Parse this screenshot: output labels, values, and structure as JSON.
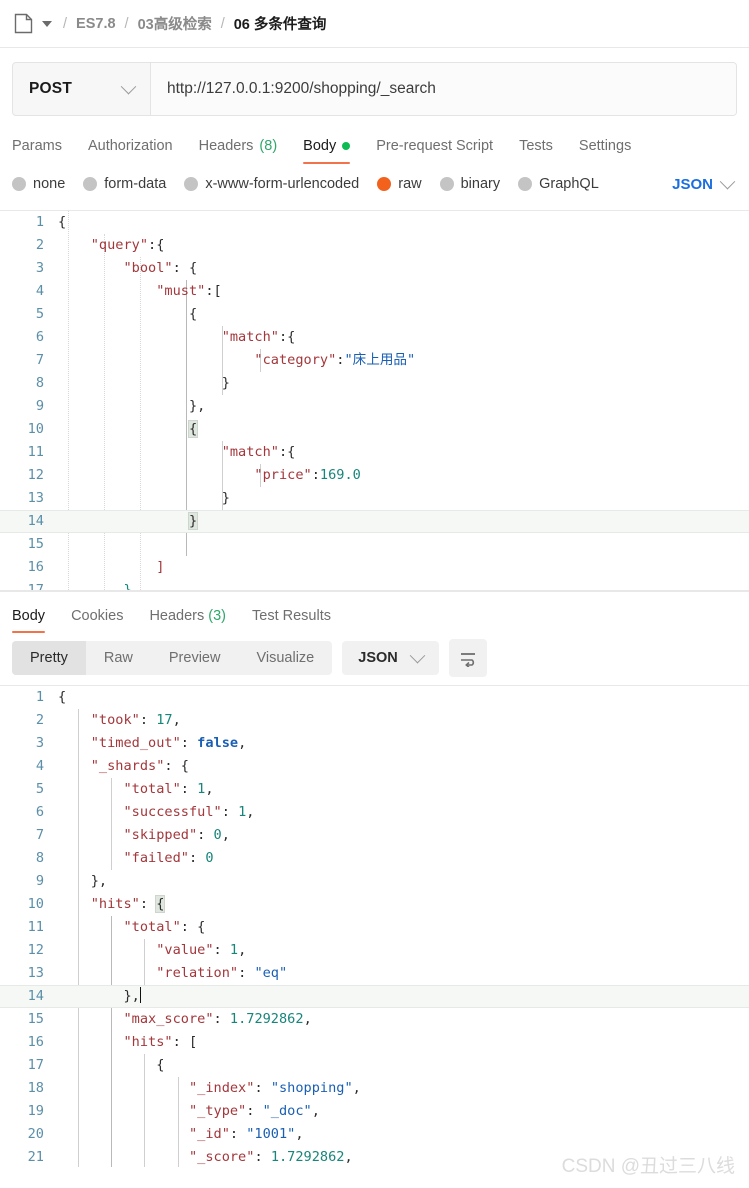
{
  "breadcrumb": {
    "doc_icon": "document-icon",
    "caret_icon": "caret-down-icon",
    "sep": "/",
    "items": [
      {
        "label": "ES7.8",
        "current": false
      },
      {
        "label": "03高级检索",
        "current": false
      },
      {
        "label": "06 多条件查询",
        "current": true
      }
    ]
  },
  "request": {
    "method": "POST",
    "method_caret": "chevron-down-icon",
    "url": "http://127.0.0.1:9200/shopping/_search",
    "tabs": [
      {
        "label": "Params",
        "active": false,
        "count": "",
        "dot": false
      },
      {
        "label": "Authorization",
        "active": false,
        "count": "",
        "dot": false
      },
      {
        "label": "Headers",
        "active": false,
        "count": "(8)",
        "dot": false
      },
      {
        "label": "Body",
        "active": true,
        "count": "",
        "dot": true
      },
      {
        "label": "Pre-request Script",
        "active": false,
        "count": "",
        "dot": false
      },
      {
        "label": "Tests",
        "active": false,
        "count": "",
        "dot": false
      },
      {
        "label": "Settings",
        "active": false,
        "count": "",
        "dot": false
      }
    ],
    "body_types": [
      {
        "label": "none",
        "selected": false
      },
      {
        "label": "form-data",
        "selected": false
      },
      {
        "label": "x-www-form-urlencoded",
        "selected": false
      },
      {
        "label": "raw",
        "selected": true
      },
      {
        "label": "binary",
        "selected": false
      },
      {
        "label": "GraphQL",
        "selected": false
      }
    ],
    "format": "JSON",
    "format_caret": "chevron-down-icon",
    "body_lines": [
      {
        "n": "1",
        "highlight": false,
        "tokens": [
          {
            "t": "{",
            "c": "p"
          }
        ]
      },
      {
        "n": "2",
        "highlight": false,
        "tokens": [
          {
            "t": "    ",
            "c": "p"
          },
          {
            "t": "\"query\"",
            "c": "k"
          },
          {
            "t": ":{",
            "c": "p"
          }
        ]
      },
      {
        "n": "3",
        "highlight": false,
        "tokens": [
          {
            "t": "        ",
            "c": "p"
          },
          {
            "t": "\"bool\"",
            "c": "k"
          },
          {
            "t": ": {",
            "c": "p"
          }
        ]
      },
      {
        "n": "4",
        "highlight": false,
        "tokens": [
          {
            "t": "            ",
            "c": "p"
          },
          {
            "t": "\"must\"",
            "c": "k"
          },
          {
            "t": ":[",
            "c": "p"
          }
        ]
      },
      {
        "n": "5",
        "highlight": false,
        "tokens": [
          {
            "t": "                ",
            "c": "p"
          },
          {
            "t": "{",
            "c": "p"
          }
        ]
      },
      {
        "n": "6",
        "highlight": false,
        "tokens": [
          {
            "t": "                    ",
            "c": "p"
          },
          {
            "t": "\"match\"",
            "c": "k"
          },
          {
            "t": ":{",
            "c": "p"
          }
        ]
      },
      {
        "n": "7",
        "highlight": false,
        "tokens": [
          {
            "t": "                        ",
            "c": "p"
          },
          {
            "t": "\"category\"",
            "c": "k"
          },
          {
            "t": ":",
            "c": "p"
          },
          {
            "t": "\"床上用品\"",
            "c": "s"
          }
        ]
      },
      {
        "n": "8",
        "highlight": false,
        "tokens": [
          {
            "t": "                    ",
            "c": "p"
          },
          {
            "t": "}",
            "c": "p"
          }
        ]
      },
      {
        "n": "9",
        "highlight": false,
        "tokens": [
          {
            "t": "                ",
            "c": "p"
          },
          {
            "t": "},",
            "c": "p"
          }
        ]
      },
      {
        "n": "10",
        "highlight": false,
        "tokens": [
          {
            "t": "                ",
            "c": "p"
          },
          {
            "t": "{",
            "c": "p bm"
          }
        ]
      },
      {
        "n": "11",
        "highlight": false,
        "tokens": [
          {
            "t": "                    ",
            "c": "p"
          },
          {
            "t": "\"match\"",
            "c": "k"
          },
          {
            "t": ":{",
            "c": "p"
          }
        ]
      },
      {
        "n": "12",
        "highlight": false,
        "tokens": [
          {
            "t": "                        ",
            "c": "p"
          },
          {
            "t": "\"price\"",
            "c": "k"
          },
          {
            "t": ":",
            "c": "p"
          },
          {
            "t": "169.0",
            "c": "n"
          }
        ]
      },
      {
        "n": "13",
        "highlight": false,
        "tokens": [
          {
            "t": "                    ",
            "c": "p"
          },
          {
            "t": "}",
            "c": "p"
          }
        ]
      },
      {
        "n": "14",
        "highlight": true,
        "tokens": [
          {
            "t": "                ",
            "c": "p"
          },
          {
            "t": "}",
            "c": "p bm"
          }
        ]
      },
      {
        "n": "15",
        "highlight": false,
        "tokens": [
          {
            "t": "",
            "c": "p"
          }
        ]
      },
      {
        "n": "16",
        "highlight": false,
        "tokens": [
          {
            "t": "            ",
            "c": "p"
          },
          {
            "t": "]",
            "c": "k"
          }
        ]
      },
      {
        "n": "17",
        "highlight": false,
        "tokens": [
          {
            "t": "        ",
            "c": "p"
          },
          {
            "t": "}",
            "c": "n"
          }
        ]
      }
    ]
  },
  "response": {
    "tabs": [
      {
        "label": "Body",
        "active": true,
        "count": ""
      },
      {
        "label": "Cookies",
        "active": false,
        "count": ""
      },
      {
        "label": "Headers",
        "active": false,
        "count": "(3)"
      },
      {
        "label": "Test Results",
        "active": false,
        "count": ""
      }
    ],
    "view_modes": [
      {
        "label": "Pretty",
        "active": true
      },
      {
        "label": "Raw",
        "active": false
      },
      {
        "label": "Preview",
        "active": false
      },
      {
        "label": "Visualize",
        "active": false
      }
    ],
    "format": "JSON",
    "format_caret": "chevron-down-icon",
    "wrap_icon": "word-wrap-icon",
    "body_lines": [
      {
        "n": "1",
        "highlight": false,
        "tokens": [
          {
            "t": "{",
            "c": "p"
          }
        ]
      },
      {
        "n": "2",
        "highlight": false,
        "tokens": [
          {
            "t": "    ",
            "c": "p"
          },
          {
            "t": "\"took\"",
            "c": "k"
          },
          {
            "t": ": ",
            "c": "p"
          },
          {
            "t": "17",
            "c": "n"
          },
          {
            "t": ",",
            "c": "p"
          }
        ]
      },
      {
        "n": "3",
        "highlight": false,
        "tokens": [
          {
            "t": "    ",
            "c": "p"
          },
          {
            "t": "\"timed_out\"",
            "c": "k"
          },
          {
            "t": ": ",
            "c": "p"
          },
          {
            "t": "false",
            "c": "b"
          },
          {
            "t": ",",
            "c": "p"
          }
        ]
      },
      {
        "n": "4",
        "highlight": false,
        "tokens": [
          {
            "t": "    ",
            "c": "p"
          },
          {
            "t": "\"_shards\"",
            "c": "k"
          },
          {
            "t": ": {",
            "c": "p"
          }
        ]
      },
      {
        "n": "5",
        "highlight": false,
        "tokens": [
          {
            "t": "        ",
            "c": "p"
          },
          {
            "t": "\"total\"",
            "c": "k"
          },
          {
            "t": ": ",
            "c": "p"
          },
          {
            "t": "1",
            "c": "n"
          },
          {
            "t": ",",
            "c": "p"
          }
        ]
      },
      {
        "n": "6",
        "highlight": false,
        "tokens": [
          {
            "t": "        ",
            "c": "p"
          },
          {
            "t": "\"successful\"",
            "c": "k"
          },
          {
            "t": ": ",
            "c": "p"
          },
          {
            "t": "1",
            "c": "n"
          },
          {
            "t": ",",
            "c": "p"
          }
        ]
      },
      {
        "n": "7",
        "highlight": false,
        "tokens": [
          {
            "t": "        ",
            "c": "p"
          },
          {
            "t": "\"skipped\"",
            "c": "k"
          },
          {
            "t": ": ",
            "c": "p"
          },
          {
            "t": "0",
            "c": "n"
          },
          {
            "t": ",",
            "c": "p"
          }
        ]
      },
      {
        "n": "8",
        "highlight": false,
        "tokens": [
          {
            "t": "        ",
            "c": "p"
          },
          {
            "t": "\"failed\"",
            "c": "k"
          },
          {
            "t": ": ",
            "c": "p"
          },
          {
            "t": "0",
            "c": "n"
          }
        ]
      },
      {
        "n": "9",
        "highlight": false,
        "tokens": [
          {
            "t": "    ",
            "c": "p"
          },
          {
            "t": "},",
            "c": "p"
          }
        ]
      },
      {
        "n": "10",
        "highlight": false,
        "tokens": [
          {
            "t": "    ",
            "c": "p"
          },
          {
            "t": "\"hits\"",
            "c": "k"
          },
          {
            "t": ": ",
            "c": "p"
          },
          {
            "t": "{",
            "c": "p bm"
          }
        ]
      },
      {
        "n": "11",
        "highlight": false,
        "tokens": [
          {
            "t": "        ",
            "c": "p"
          },
          {
            "t": "\"total\"",
            "c": "k"
          },
          {
            "t": ": {",
            "c": "p"
          }
        ]
      },
      {
        "n": "12",
        "highlight": false,
        "tokens": [
          {
            "t": "            ",
            "c": "p"
          },
          {
            "t": "\"value\"",
            "c": "k"
          },
          {
            "t": ": ",
            "c": "p"
          },
          {
            "t": "1",
            "c": "n"
          },
          {
            "t": ",",
            "c": "p"
          }
        ]
      },
      {
        "n": "13",
        "highlight": false,
        "tokens": [
          {
            "t": "            ",
            "c": "p"
          },
          {
            "t": "\"relation\"",
            "c": "k"
          },
          {
            "t": ": ",
            "c": "p"
          },
          {
            "t": "\"eq\"",
            "c": "s"
          }
        ]
      },
      {
        "n": "14",
        "highlight": true,
        "tokens": [
          {
            "t": "        ",
            "c": "p"
          },
          {
            "t": "},",
            "c": "p"
          }
        ],
        "caret": true
      },
      {
        "n": "15",
        "highlight": false,
        "tokens": [
          {
            "t": "        ",
            "c": "p"
          },
          {
            "t": "\"max_score\"",
            "c": "k"
          },
          {
            "t": ": ",
            "c": "p"
          },
          {
            "t": "1.7292862",
            "c": "n"
          },
          {
            "t": ",",
            "c": "p"
          }
        ]
      },
      {
        "n": "16",
        "highlight": false,
        "tokens": [
          {
            "t": "        ",
            "c": "p"
          },
          {
            "t": "\"hits\"",
            "c": "k"
          },
          {
            "t": ": [",
            "c": "p"
          }
        ]
      },
      {
        "n": "17",
        "highlight": false,
        "tokens": [
          {
            "t": "            ",
            "c": "p"
          },
          {
            "t": "{",
            "c": "p"
          }
        ]
      },
      {
        "n": "18",
        "highlight": false,
        "tokens": [
          {
            "t": "                ",
            "c": "p"
          },
          {
            "t": "\"_index\"",
            "c": "k"
          },
          {
            "t": ": ",
            "c": "p"
          },
          {
            "t": "\"shopping\"",
            "c": "s"
          },
          {
            "t": ",",
            "c": "p"
          }
        ]
      },
      {
        "n": "19",
        "highlight": false,
        "tokens": [
          {
            "t": "                ",
            "c": "p"
          },
          {
            "t": "\"_type\"",
            "c": "k"
          },
          {
            "t": ": ",
            "c": "p"
          },
          {
            "t": "\"_doc\"",
            "c": "s"
          },
          {
            "t": ",",
            "c": "p"
          }
        ]
      },
      {
        "n": "20",
        "highlight": false,
        "tokens": [
          {
            "t": "                ",
            "c": "p"
          },
          {
            "t": "\"_id\"",
            "c": "k"
          },
          {
            "t": ": ",
            "c": "p"
          },
          {
            "t": "\"1001\"",
            "c": "s"
          },
          {
            "t": ",",
            "c": "p"
          }
        ]
      },
      {
        "n": "21",
        "highlight": false,
        "tokens": [
          {
            "t": "                ",
            "c": "p"
          },
          {
            "t": "\"_score\"",
            "c": "k"
          },
          {
            "t": ": ",
            "c": "p"
          },
          {
            "t": "1.7292862",
            "c": "n"
          },
          {
            "t": ",",
            "c": "p"
          }
        ]
      }
    ]
  },
  "watermark": "CSDN @丑过三八线",
  "colors": {
    "accent_orange": "#f2734a",
    "radio_orange": "#f2621d",
    "green_dot": "#0cbb52",
    "link_blue": "#1a6ee0",
    "count_green": "#2fa86a"
  }
}
